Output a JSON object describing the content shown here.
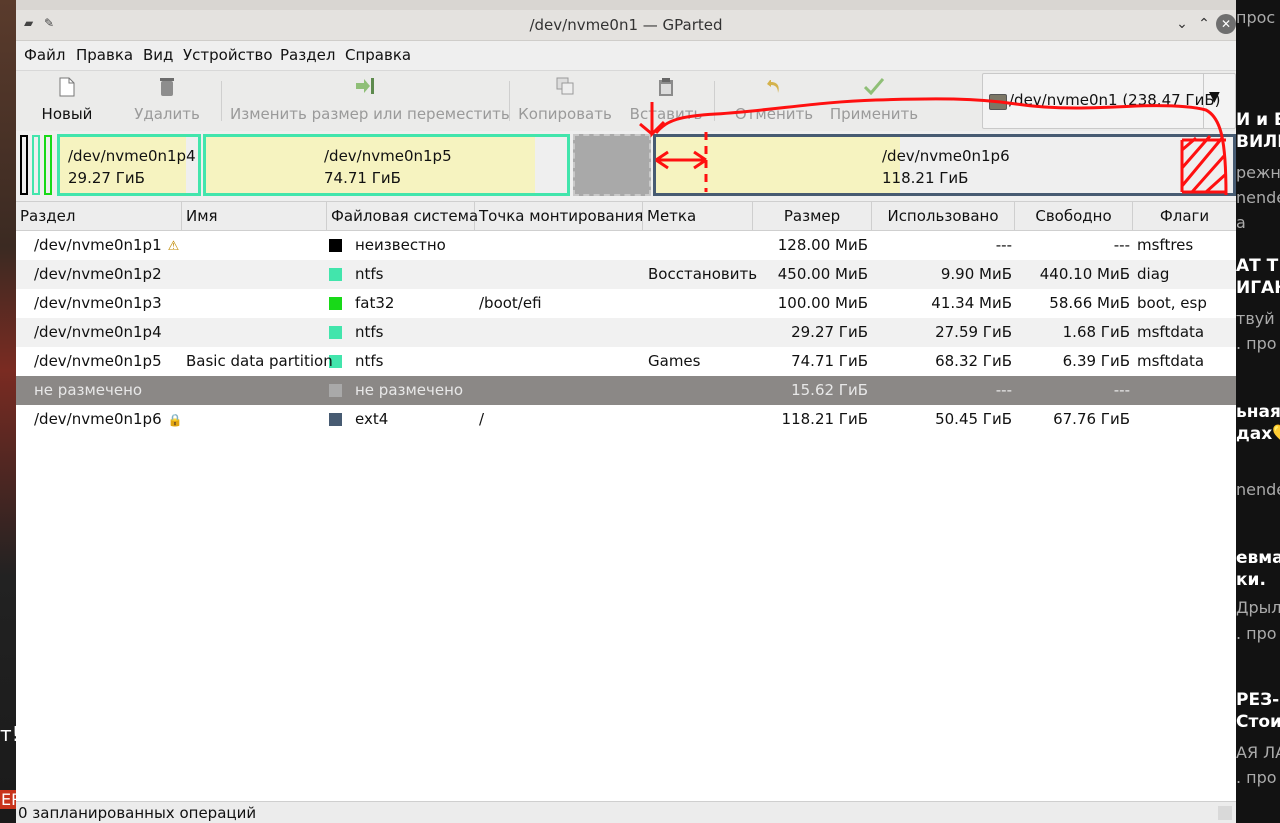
{
  "window": {
    "title": "/dev/nvme0n1 — GParted"
  },
  "menu": [
    "Файл",
    "Правка",
    "Вид",
    "Устройство",
    "Раздел",
    "Справка"
  ],
  "toolbar": {
    "new": "Новый",
    "delete": "Удалить",
    "resize": "Изменить размер или переместить",
    "copy": "Копировать",
    "paste": "Вставить",
    "undo": "Отменить",
    "apply": "Применить",
    "device": "/dev/nvme0n1  (238.47 ГиБ)"
  },
  "diskmap": {
    "p4": {
      "name": "/dev/nvme0n1p4",
      "size": "29.27 ГиБ"
    },
    "p5": {
      "name": "/dev/nvme0n1p5",
      "size": "74.71 ГиБ"
    },
    "p6": {
      "name": "/dev/nvme0n1p6",
      "size": "118.21 ГиБ"
    }
  },
  "columns": [
    "Раздел",
    "Имя",
    "Файловая система",
    "Точка монтирования",
    "Метка",
    "Размер",
    "Использовано",
    "Свободно",
    "Флаги"
  ],
  "colors": {
    "unknown": "#000000",
    "ntfs": "#42e5ac",
    "fat32": "#18d918",
    "unallocated": "#a9a9a9",
    "ext4": "#475b72",
    "usage_fill": "#f6f3c0",
    "annotation": "#ff1010"
  },
  "rows": [
    {
      "partition": "/dev/nvme0n1p1",
      "name": "",
      "fs": "неизвестно",
      "mount": "",
      "label": "",
      "size": "128.00 МиБ",
      "used": "---",
      "free": "---",
      "flags": "msftres",
      "fs_color": "#000000"
    },
    {
      "partition": "/dev/nvme0n1p2",
      "name": "",
      "fs": "ntfs",
      "mount": "",
      "label": "Восстановить",
      "size": "450.00 МиБ",
      "used": "9.90 МиБ",
      "free": "440.10 МиБ",
      "flags": "diag",
      "fs_color": "#42e5ac"
    },
    {
      "partition": "/dev/nvme0n1p3",
      "name": "",
      "fs": "fat32",
      "mount": "/boot/efi",
      "label": "",
      "size": "100.00 МиБ",
      "used": "41.34 МиБ",
      "free": "58.66 МиБ",
      "flags": "boot, esp",
      "fs_color": "#18d918"
    },
    {
      "partition": "/dev/nvme0n1p4",
      "name": "",
      "fs": "ntfs",
      "mount": "",
      "label": "",
      "size": "29.27 ГиБ",
      "used": "27.59 ГиБ",
      "free": "1.68 ГиБ",
      "flags": "msftdata",
      "fs_color": "#42e5ac"
    },
    {
      "partition": "/dev/nvme0n1p5",
      "name": "Basic data partition",
      "fs": "ntfs",
      "mount": "",
      "label": "Games",
      "size": "74.71 ГиБ",
      "used": "68.32 ГиБ",
      "free": "6.39 ГиБ",
      "flags": "msftdata",
      "fs_color": "#42e5ac"
    },
    {
      "partition": "не размечено",
      "name": "",
      "fs": "не размечено",
      "mount": "",
      "label": "",
      "size": "15.62 ГиБ",
      "used": "---",
      "free": "---",
      "flags": "",
      "fs_color": "#a9a9a9"
    },
    {
      "partition": "/dev/nvme0n1p6",
      "name": "",
      "fs": "ext4",
      "mount": "/",
      "label": "",
      "size": "118.21 ГиБ",
      "used": "50.45 ГиБ",
      "free": "67.76 ГиБ",
      "flags": "",
      "fs_color": "#475b72"
    }
  ],
  "status": "0 запланированных операций",
  "background": {
    "left_texts": [
      "т!",
      "ER"
    ],
    "right_texts": [
      "прос",
      "И и Б",
      "ВИЛИ",
      "режне",
      "nende",
      "а",
      "АТ Т",
      "ИГАН",
      "твуй С",
      ". про",
      "ьная",
      "дах💛",
      "nende",
      "евма",
      "ки.",
      "Дрыло",
      ". про",
      "РЕЗ-",
      "Стои",
      "АЯ ЛА",
      ". про"
    ]
  }
}
